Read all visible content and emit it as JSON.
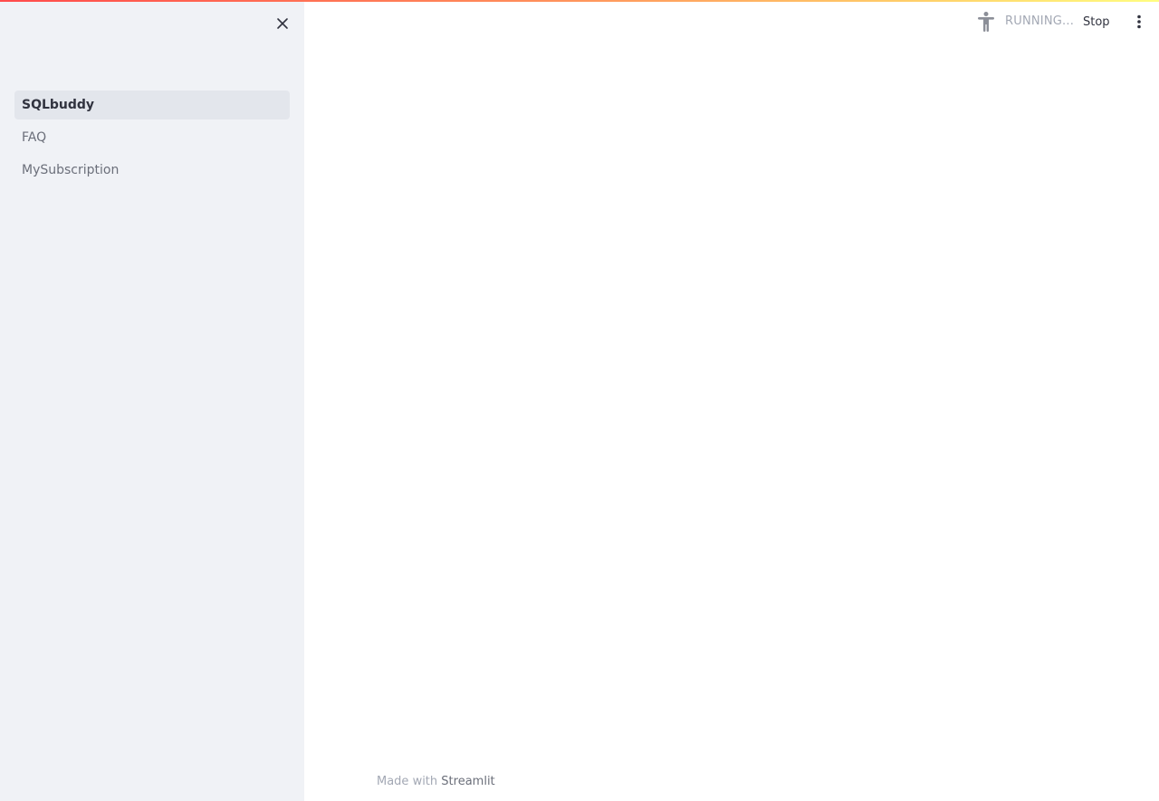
{
  "sidebar": {
    "nav_items": [
      {
        "label": "SQLbuddy",
        "active": true
      },
      {
        "label": "FAQ",
        "active": false
      },
      {
        "label": "MySubscription",
        "active": false
      }
    ]
  },
  "header": {
    "status_text": "RUNNING...",
    "stop_label": "Stop"
  },
  "footer": {
    "made_with": "Made with",
    "link_text": "Streamlit"
  },
  "icons": {
    "close": "close-icon",
    "status": "running-figure-icon",
    "menu": "vertical-dots-icon"
  },
  "colors": {
    "sidebar_bg": "#f0f2f6",
    "active_item_bg": "#e3e6ec",
    "text_dark": "#31333f",
    "text_muted": "#6b6f7a",
    "accent_start": "#ff4b4b",
    "accent_end": "#fffd80"
  }
}
